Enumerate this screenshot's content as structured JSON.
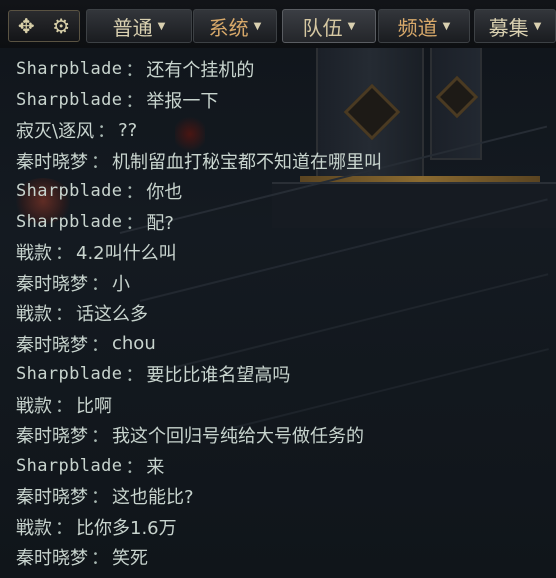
{
  "toolbar": {
    "move_icon": "move-arrows-icon",
    "settings_icon": "gear-icon"
  },
  "tabs": [
    {
      "label": "普通",
      "arrow": "▼",
      "active": false,
      "color": "#d9d0b0"
    },
    {
      "label": "系统",
      "arrow": "▼",
      "active": false,
      "color": "#d8a96a"
    },
    {
      "label": "队伍",
      "arrow": "▼",
      "active": true,
      "color": "#d6c8a2"
    },
    {
      "label": "频道",
      "arrow": "▼",
      "active": false,
      "color": "#d8a96a"
    },
    {
      "label": "募集",
      "arrow": "▼",
      "active": false,
      "color": "#d9d0b0"
    }
  ],
  "chat": {
    "separator": "：",
    "messages": [
      {
        "name": "Sharpblade",
        "text": "还有个挂机的"
      },
      {
        "name": "Sharpblade",
        "text": "举报一下"
      },
      {
        "name": "寂灭\\逐风",
        "text": "??"
      },
      {
        "name": "秦时晓梦",
        "text": "机制留血打秘宝都不知道在哪里叫"
      },
      {
        "name": "Sharpblade",
        "text": "你也"
      },
      {
        "name": "Sharpblade",
        "text": "配?"
      },
      {
        "name": "戦款",
        "text": "4.2叫什么叫"
      },
      {
        "name": "秦时晓梦",
        "text": "小"
      },
      {
        "name": "戦款",
        "text": "话这么多"
      },
      {
        "name": "秦时晓梦",
        "text": "chou"
      },
      {
        "name": "Sharpblade",
        "text": "要比比谁名望高吗"
      },
      {
        "name": "戦款",
        "text": "比啊"
      },
      {
        "name": "秦时晓梦",
        "text": "我这个回归号纯给大号做任务的"
      },
      {
        "name": "Sharpblade",
        "text": "来"
      },
      {
        "name": "秦时晓梦",
        "text": "这也能比?"
      },
      {
        "name": "戦款",
        "text": "比你多1.6万"
      },
      {
        "name": "秦时晓梦",
        "text": "笑死"
      }
    ]
  }
}
